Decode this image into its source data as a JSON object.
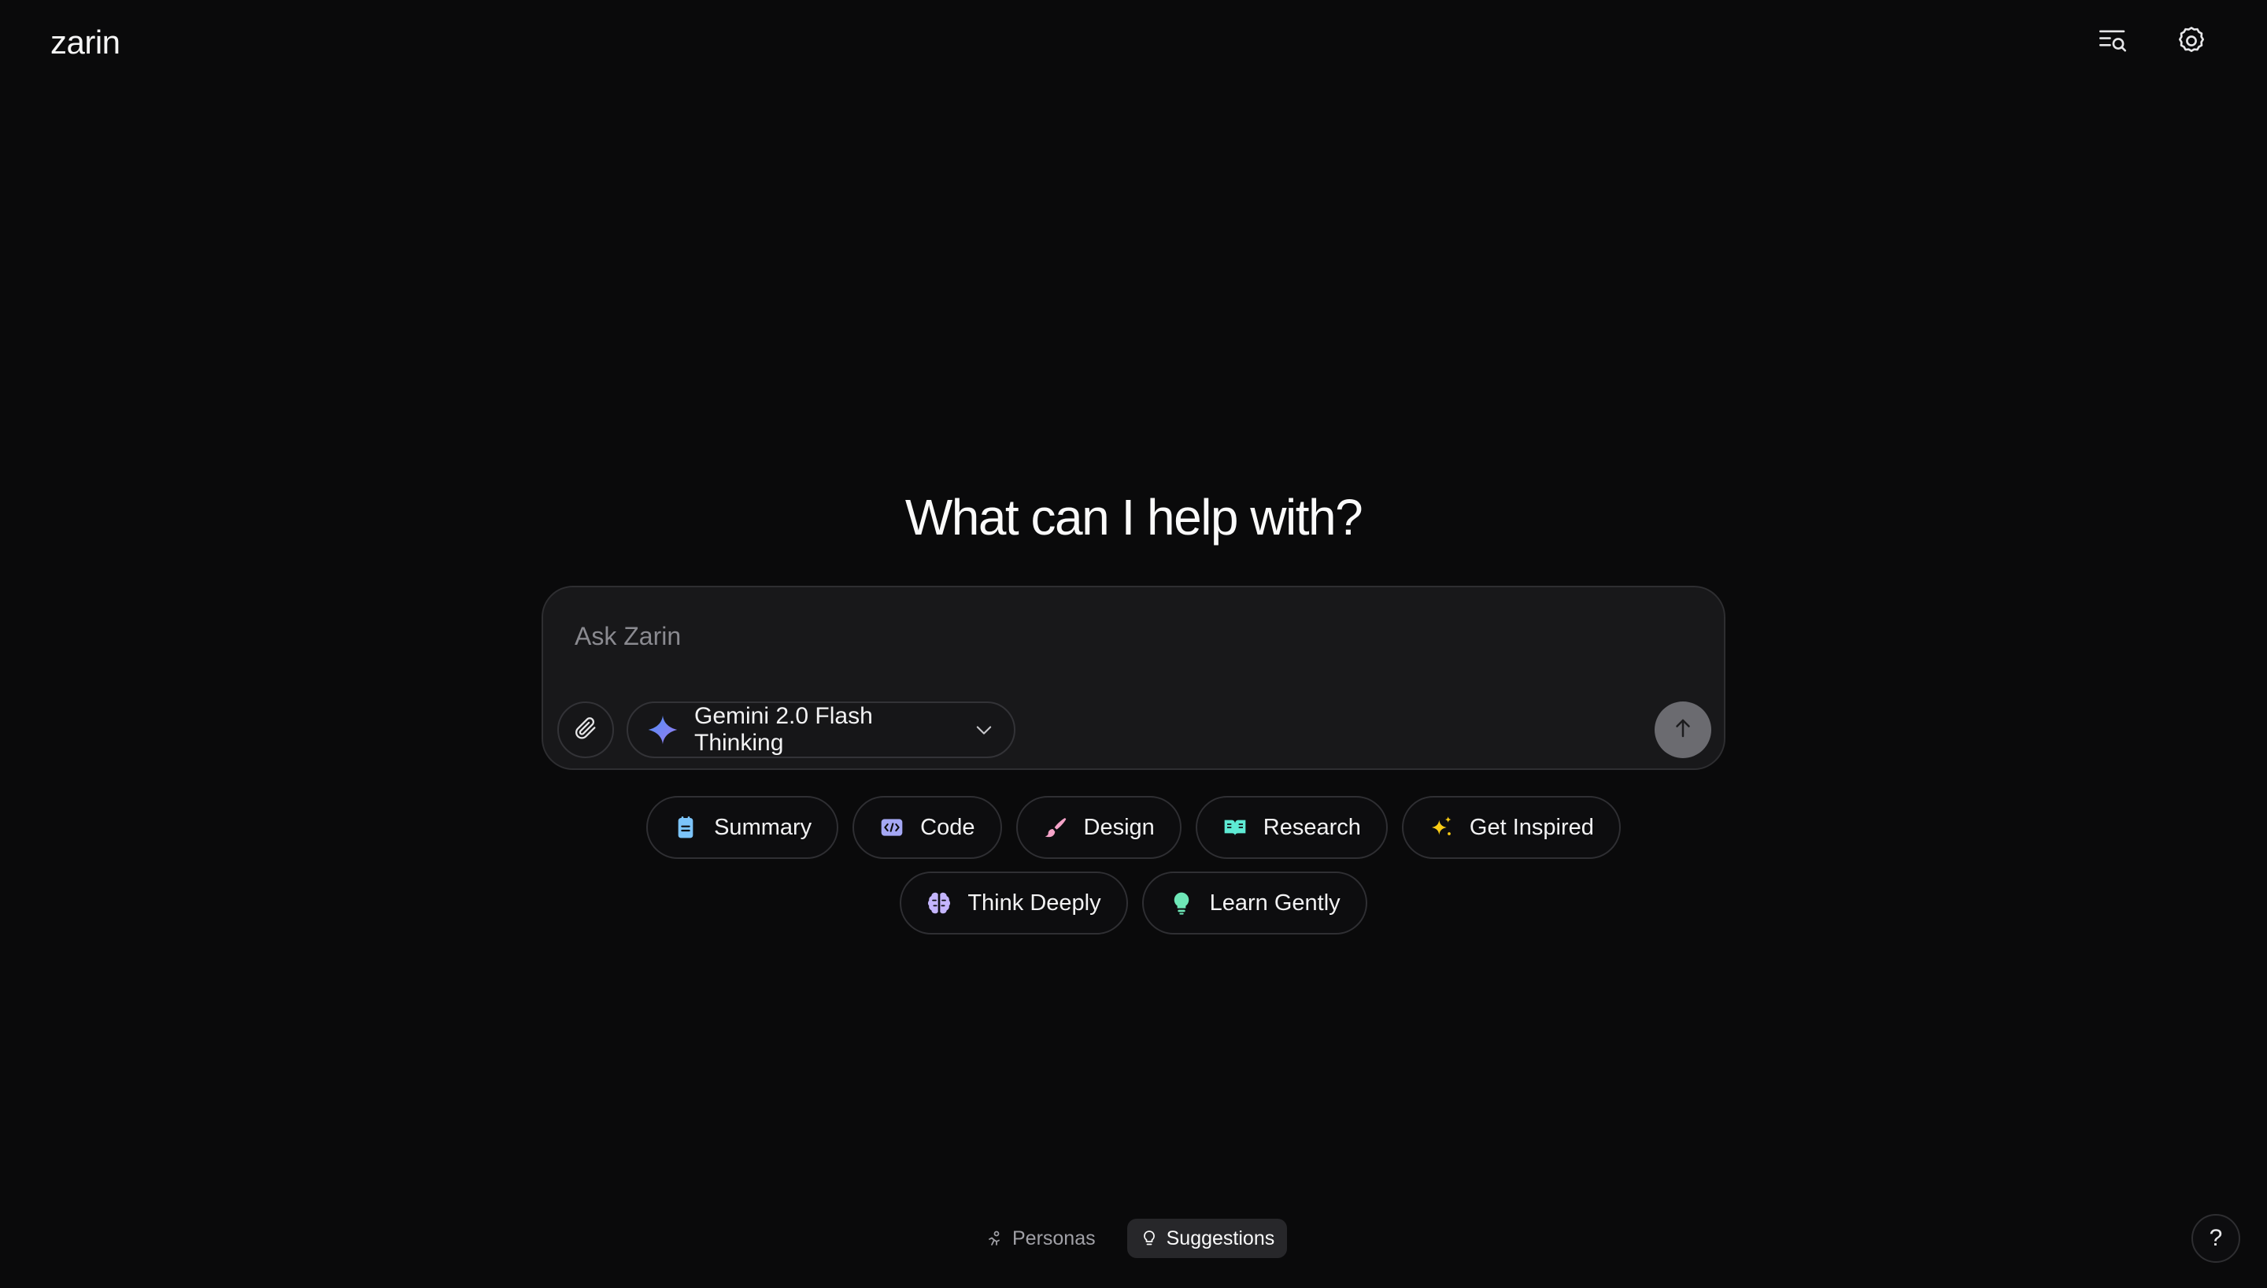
{
  "app": {
    "logo": "zarin"
  },
  "header": {
    "icons": [
      "search-history-icon",
      "gear-icon"
    ]
  },
  "main": {
    "headline": "What can I help with?",
    "composer": {
      "placeholder": "Ask Zarin",
      "value": "",
      "model": "Gemini 2.0 Flash Thinking"
    },
    "suggestions": [
      {
        "label": "Summary",
        "icon": "notepad-icon",
        "color": "#7cc4fa"
      },
      {
        "label": "Code",
        "icon": "code-icon",
        "color": "#a5a8f5"
      },
      {
        "label": "Design",
        "icon": "brush-icon",
        "color": "#f4a3c8"
      },
      {
        "label": "Research",
        "icon": "book-icon",
        "color": "#5eead4"
      },
      {
        "label": "Get Inspired",
        "icon": "sparkles-icon",
        "color": "#facc15"
      },
      {
        "label": "Think Deeply",
        "icon": "brain-icon",
        "color": "#c4b5fd"
      },
      {
        "label": "Learn Gently",
        "icon": "lightbulb-icon",
        "color": "#6ee7b7"
      }
    ]
  },
  "footer": {
    "modes": [
      {
        "label": "Personas",
        "active": false
      },
      {
        "label": "Suggestions",
        "active": true
      }
    ],
    "help": "?"
  },
  "colors": {
    "background": "#0a0a0b",
    "surface": "#18181a",
    "accent_gem": "#8b8ff5"
  }
}
